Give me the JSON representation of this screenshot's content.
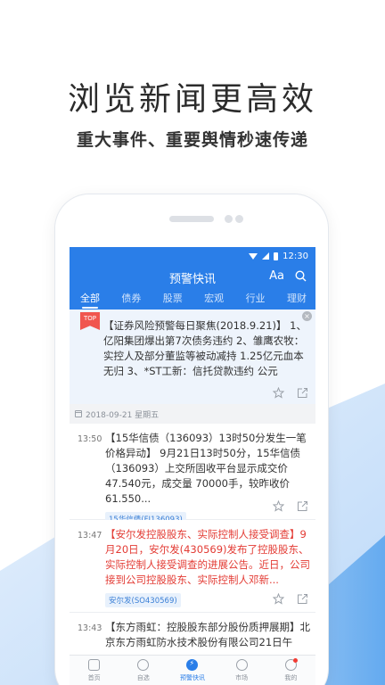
{
  "promo": {
    "headline": "浏览新闻更高效",
    "subline": "重大事件、重要舆情秒速传递"
  },
  "status_bar": {
    "time": "12:30"
  },
  "header": {
    "title": "预警快讯",
    "font_button": "Aa"
  },
  "tabs": [
    {
      "label": "全部",
      "active": true
    },
    {
      "label": "债券",
      "active": false
    },
    {
      "label": "股票",
      "active": false
    },
    {
      "label": "宏观",
      "active": false
    },
    {
      "label": "行业",
      "active": false
    },
    {
      "label": "理财",
      "active": false
    }
  ],
  "top_card": {
    "badge": "TOP",
    "text": "【证券风险预警每日聚焦(2018.9.21)】 1、亿阳集团爆出第7次债务违约 2、雏鹰农牧：实控人及部分董监等被动减持 1.25亿元血本无归 3、*ST工新：信托贷款违约 公元"
  },
  "date_header": "2018-09-21 星期五",
  "news": [
    {
      "time": "13:50",
      "text": "【15华信债（136093）13时50分发生一笔价格异动】  9月21日13时50分，15华信债（136093）上交所固收平台显示成交价47.540元，成交量 70000手，较昨收价61.550...",
      "tag": "15华信债(FI136093)",
      "highlight": false
    },
    {
      "time": "13:47",
      "text": "【安尔发控股股东、实际控制人接受调查】9月20日，安尔发(430569)发布了控股股东、实际控制人接受调查的进展公告。近日，公司接到公司控股股东、实际控制人邓新...",
      "tag": "安尔发(SO430569)",
      "highlight": true
    },
    {
      "time": "13:43",
      "text": "【东方雨虹：控股股东部分股份质押展期】北京东方雨虹防水技术股份有限公司21日午",
      "tag": "",
      "highlight": false
    }
  ],
  "bottom_nav": [
    {
      "label": "首页",
      "icon": "home-icon",
      "active": false
    },
    {
      "label": "自选",
      "icon": "eye-icon",
      "active": false
    },
    {
      "label": "预警快讯",
      "icon": "lightning-icon",
      "active": true
    },
    {
      "label": "市场",
      "icon": "compass-icon",
      "active": false
    },
    {
      "label": "我的",
      "icon": "user-icon",
      "active": false
    }
  ],
  "colors": {
    "brand_blue": "#2a7ee8",
    "alert_red": "#e33b34",
    "top_badge": "#f0564f"
  }
}
